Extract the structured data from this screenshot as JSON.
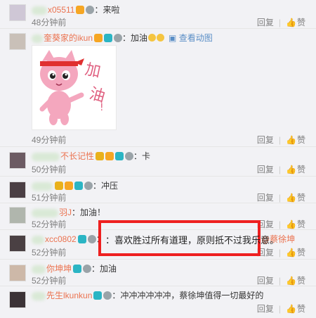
{
  "comments": [
    {
      "user": "x05511",
      "text": "：来啦",
      "time": "48分钟前"
    },
    {
      "user": "奎葵家的ikun",
      "text": "：加油",
      "link": "查看动图",
      "time": "49分钟前"
    },
    {
      "user": "不长记性",
      "text": "：卡",
      "time": "50分钟前"
    },
    {
      "user": "",
      "text": "：冲压",
      "time": "51分钟前"
    },
    {
      "user": "羽J",
      "text": "：加油！",
      "time": "52分钟前"
    },
    {
      "user": "xcc0802",
      "text": "：",
      "mention": "@蔡徐坤",
      "time": "52分钟前"
    },
    {
      "user": "你坤坤",
      "text": "：加油",
      "time": "52分钟前"
    },
    {
      "user": "先生lkunkun",
      "text": "：冲冲冲冲冲冲，蔡徐坤值得一切最好的",
      "time": ""
    }
  ],
  "actions": {
    "reply": "回复",
    "like": "赞"
  },
  "highlight_text": "：喜欢胜过所有道理，原则抵不过我乐意。",
  "colors": {
    "username": "#eb7350",
    "highlight_border": "#ee2020",
    "link": "#5a8ec6"
  },
  "icons": [
    "badge-icon",
    "heart-icon",
    "thumbs-up-icon",
    "cat-sticker"
  ]
}
